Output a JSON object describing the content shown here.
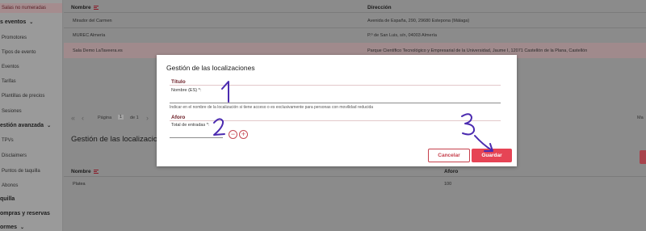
{
  "sidebar": {
    "items": [
      {
        "label": "Salas no numeradas",
        "type": "active"
      },
      {
        "label": "s eventos",
        "type": "head"
      },
      {
        "label": "Promotores",
        "type": "sub"
      },
      {
        "label": "Tipos de evento",
        "type": "sub"
      },
      {
        "label": "Eventos",
        "type": "sub"
      },
      {
        "label": "Tarifas",
        "type": "sub"
      },
      {
        "label": "Plantillas de precios",
        "type": "sub"
      },
      {
        "label": "Sesiones",
        "type": "sub"
      },
      {
        "label": "estión avanzada",
        "type": "head"
      },
      {
        "label": "TPVs",
        "type": "sub"
      },
      {
        "label": "Disclaimers",
        "type": "sub"
      },
      {
        "label": "Puntos de taquilla",
        "type": "sub"
      },
      {
        "label": "Abonos",
        "type": "sub"
      },
      {
        "label": "quilla",
        "type": "head"
      },
      {
        "label": "ompras y reservas",
        "type": "head"
      },
      {
        "label": "ormes",
        "type": "head"
      }
    ]
  },
  "main": {
    "table": {
      "headers": {
        "name": "Nombre",
        "address": "Dirección"
      },
      "rows": [
        {
          "name": "Mirador del Carmen",
          "address": "Avenida de España, 290, 29680 Estepona (Málaga)"
        },
        {
          "name": "MUREC Almería",
          "address": "P.º de San Luis, s/n, 04003 Almería"
        },
        {
          "name": "Sala Demo LaTaveera.es",
          "address": "Parque Científico Tecnológico y Empresarial de la Universidad, Jaume I, 12071 Castellón de la Plana, Castellón"
        }
      ]
    },
    "pager": {
      "page_label": "Página",
      "page": "1",
      "of_label": "de 1",
      "right_cut": "Ma"
    },
    "section_title": "Gestión de las localizaciones",
    "loc_table": {
      "headers": {
        "name": "Nombre",
        "capacity": "Aforo"
      },
      "rows": [
        {
          "name": "Platea",
          "capacity": "100"
        }
      ]
    }
  },
  "modal": {
    "title": "Gestión de las localizaciones",
    "title_section": "Título",
    "name_label": "Nombre (ES) *:",
    "name_value": "",
    "hint": "Indicar en el nombre de la localización si tiene acceso o es exclusivamente para personas con movilidad reducida",
    "aforo_section": "Aforo",
    "entries_label": "Total de entradas *:",
    "entries_value": "",
    "minus": "−",
    "plus": "+",
    "cancel": "Cancelar",
    "save": "Guardar"
  },
  "colors": {
    "accent": "#e64455",
    "dark_accent": "#6b1b24",
    "annotation": "#4b2bb0"
  }
}
